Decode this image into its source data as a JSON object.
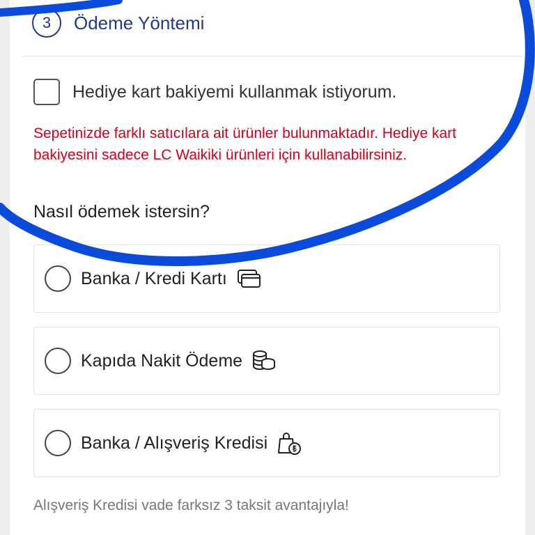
{
  "payment_section": {
    "step_number": "3",
    "title": "Ödeme Yöntemi"
  },
  "gift_card": {
    "label": "Hediye kart bakiyemi kullanmak istiyorum.",
    "checked": false,
    "warning": "Sepetinizde farklı satıcılara ait ürünler bulunmaktadır. Hediye kart bakiyesini sadece LC Waikiki ürünleri için kullanabilirsiniz."
  },
  "payment_question": "Nasıl ödemek istersin?",
  "options": [
    {
      "label": "Banka / Kredi Kartı",
      "icon": "credit-card-icon",
      "selected": false
    },
    {
      "label": "Kapıda Nakit Ödeme",
      "icon": "coins-stack-icon",
      "selected": false
    },
    {
      "label": "Banka / Alışveriş Kredisi",
      "icon": "shopping-bag-lira-icon",
      "selected": false
    }
  ],
  "installment_note": "Alışveriş Kredisi vade farksız 3 taksit avantajıyla!",
  "colors": {
    "brand_blue": "#1f3a8a",
    "warning_red": "#d0021b",
    "annotation_blue": "#0a4bdc"
  }
}
